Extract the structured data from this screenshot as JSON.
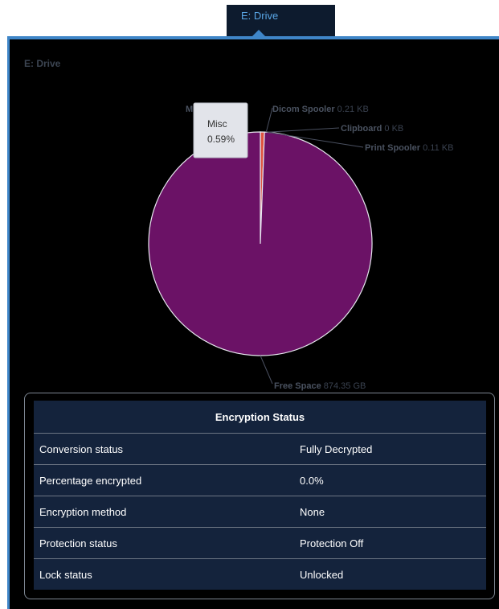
{
  "tab": {
    "label": "E: Drive"
  },
  "panel": {
    "title": "E: Drive"
  },
  "chart_data": {
    "type": "pie",
    "title": "",
    "slices": [
      {
        "label": "Free Space",
        "value_text": "874.35 GB",
        "percent": 99.41,
        "color": "#6b1266"
      },
      {
        "label": "Misc",
        "value_text": "",
        "percent": 0.59,
        "color": "#e0533f"
      },
      {
        "label": "Dicom Spooler",
        "value_text": "0.21 KB",
        "percent": 0.0,
        "color": "#e0533f"
      },
      {
        "label": "Clipboard",
        "value_text": "0 KB",
        "percent": 0.0,
        "color": "#e0533f"
      },
      {
        "label": "Print Spooler",
        "value_text": "0.11 KB",
        "percent": 0.0,
        "color": "#e0533f"
      }
    ],
    "tooltip": {
      "label": "Misc",
      "value": "0.59%"
    },
    "truncated_label": "M"
  },
  "encryption": {
    "title": "Encryption Status",
    "rows": [
      {
        "label": "Conversion status",
        "value": "Fully Decrypted"
      },
      {
        "label": "Percentage encrypted",
        "value": "0.0%"
      },
      {
        "label": "Encryption method",
        "value": "None"
      },
      {
        "label": "Protection status",
        "value": "Protection Off"
      },
      {
        "label": "Lock status",
        "value": "Unlocked"
      }
    ]
  },
  "colors": {
    "tab_background": "#0d1b2e",
    "tab_text": "#5aa7e6",
    "frame_accent": "#3f86c8",
    "panel_background": "#000000",
    "table_background": "#14233c",
    "free_space": "#6b1266",
    "misc_slice": "#e0533f",
    "label_text": "#3c4552"
  }
}
